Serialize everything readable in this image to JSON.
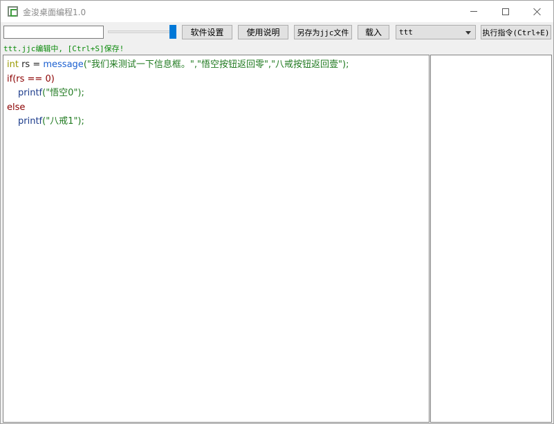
{
  "window": {
    "title": "金浚桌面编程1.0"
  },
  "toolbar": {
    "input_value": "",
    "slider_value": 1.0,
    "settings_label": "软件设置",
    "help_label": "使用说明",
    "saveas_label": "另存为jjc文件",
    "load_label": "载入",
    "select_value": "ttt",
    "exec_label": "执行指令(Ctrl+E)"
  },
  "status": {
    "text": "ttt.jjc编辑中, [Ctrl+S]保存!"
  },
  "editor": {
    "line1": {
      "kw": "int",
      "var": " rs = ",
      "fn": "message",
      "args": "(\"我们来测试一下信息框。\",\"悟空按钮返回零\",\"八戒按钮返回壹\");"
    },
    "line2": {
      "kw": "if",
      "cond": "(rs == 0)"
    },
    "line3": {
      "fn": "printf",
      "args": "(\"悟空0\");"
    },
    "line4": {
      "kw": "else"
    },
    "line5": {
      "fn": "printf",
      "args": "(\"八戒1\");"
    }
  },
  "colors": {
    "slider_accent": "#0078d7",
    "status_text": "#0a8a0a"
  }
}
